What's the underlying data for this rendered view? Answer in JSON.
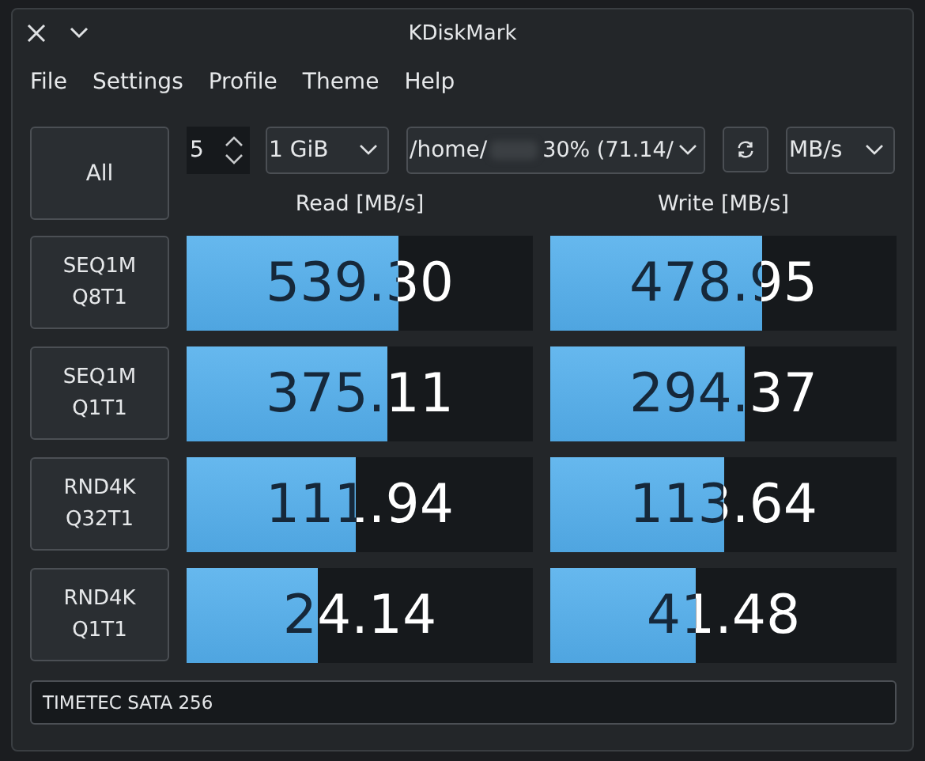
{
  "window": {
    "title": "KDiskMark"
  },
  "menu": [
    "File",
    "Settings",
    "Profile",
    "Theme",
    "Help"
  ],
  "toolbar": {
    "all_button": "All",
    "runs": "5",
    "size": "1 GiB",
    "path": "/home/",
    "usage": "30% (71.14/",
    "unit": "MB/s"
  },
  "headers": {
    "read": "Read [MB/s]",
    "write": "Write [MB/s]"
  },
  "tests": [
    {
      "label": [
        "SEQ1M",
        "Q8T1"
      ],
      "read": {
        "value": "539.30",
        "level": 0.61
      },
      "write": {
        "value": "478.95",
        "level": 0.61
      }
    },
    {
      "label": [
        "SEQ1M",
        "Q1T1"
      ],
      "read": {
        "value": "375.11",
        "level": 0.58
      },
      "write": {
        "value": "294.37",
        "level": 0.56
      }
    },
    {
      "label": [
        "RND4K",
        "Q32T1"
      ],
      "read": {
        "value": "111.94",
        "level": 0.49
      },
      "write": {
        "value": "113.64",
        "level": 0.5
      }
    },
    {
      "label": [
        "RND4K",
        "Q1T1"
      ],
      "read": {
        "value": "24.14",
        "level": 0.38
      },
      "write": {
        "value": "41.48",
        "level": 0.42
      }
    }
  ],
  "device": "TIMETEC SATA 256"
}
